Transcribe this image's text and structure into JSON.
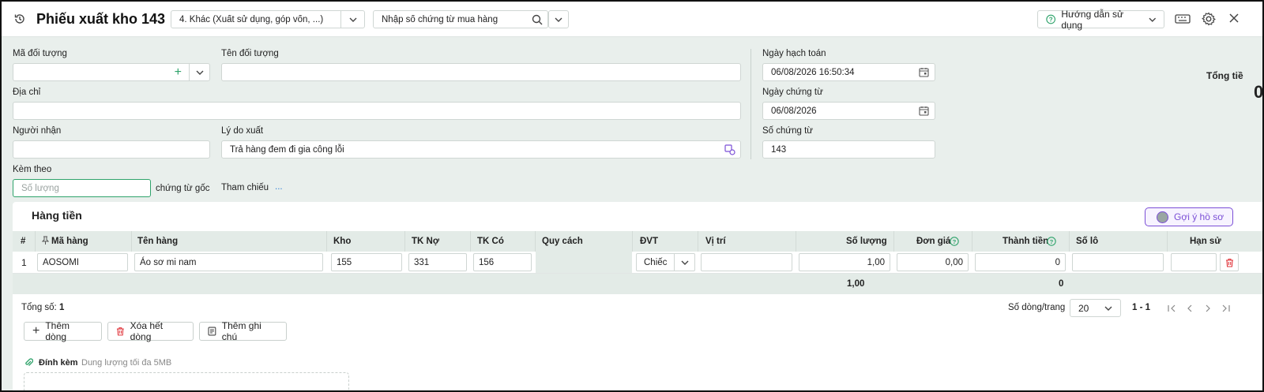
{
  "header": {
    "title": "Phiếu xuất kho 143",
    "type_select": "4. Khác (Xuất sử dụng, góp vốn, ...)",
    "search_placeholder": "Nhập số chứng từ mua hàng",
    "guide_label": "Hướng dẫn sử dụng"
  },
  "form": {
    "ma_doi_tuong_label": "Mã đối tượng",
    "ten_doi_tuong_label": "Tên đối tượng",
    "dia_chi_label": "Địa chỉ",
    "nguoi_nhan_label": "Người nhận",
    "ly_do_xuat_label": "Lý do xuất",
    "ly_do_xuat_value": "Trả hàng đem đi gia công lỗi",
    "kem_theo_label": "Kèm theo",
    "kem_theo_placeholder": "Số lượng",
    "chung_tu_goc": "chứng từ gốc",
    "tham_chieu_label": "Tham chiếu",
    "tham_chieu_more": "...",
    "ngay_hach_toan_label": "Ngày hạch toán",
    "ngay_hach_toan_value": "06/08/2026 16:50:34",
    "ngay_chung_tu_label": "Ngày chứng từ",
    "ngay_chung_tu_value": "06/08/2026",
    "so_chung_tu_label": "Số chứng từ",
    "so_chung_tu_value": "143",
    "tong_tien_label": "Tổng tiề",
    "tong_tien_value": "0"
  },
  "grid": {
    "section_title": "Hàng tiền",
    "suggest_button": "Gợi ý hồ sơ",
    "columns": [
      "#",
      "Mã hàng",
      "Tên hàng",
      "Kho",
      "TK Nợ",
      "TK Có",
      "Quy cách",
      "ĐVT",
      "Vị trí",
      "Số lượng",
      "Đơn giá",
      "Thành tiền",
      "Số lô",
      "Hạn sử"
    ],
    "rows": [
      {
        "no": "1",
        "ma_hang": "AOSOMI",
        "ten_hang": "Áo sơ mi nam",
        "kho": "155",
        "tk_no": "331",
        "tk_co": "156",
        "quy_cach": "",
        "dvt": "Chiếc",
        "vi_tri": "",
        "so_luong": "1,00",
        "don_gia": "0,00",
        "thanh_tien": "0",
        "so_lo": "",
        "han_su": ""
      }
    ],
    "totals": {
      "so_luong": "1,00",
      "thanh_tien": "0"
    },
    "total_count_label": "Tổng số:",
    "total_count_value": "1",
    "rows_per_page_label": "Số dòng/trang",
    "rows_per_page_value": "20",
    "page_range": "1 - 1"
  },
  "actions": {
    "add_row": "Thêm dòng",
    "delete_all": "Xóa hết dòng",
    "add_note": "Thêm ghi chú"
  },
  "attach": {
    "label": "Đính kèm",
    "hint": "Dung lượng tối đa 5MB"
  },
  "colors": {
    "accent_green": "#2fa36b",
    "purple": "#7b4fd6",
    "delete_red": "#e0343a"
  }
}
